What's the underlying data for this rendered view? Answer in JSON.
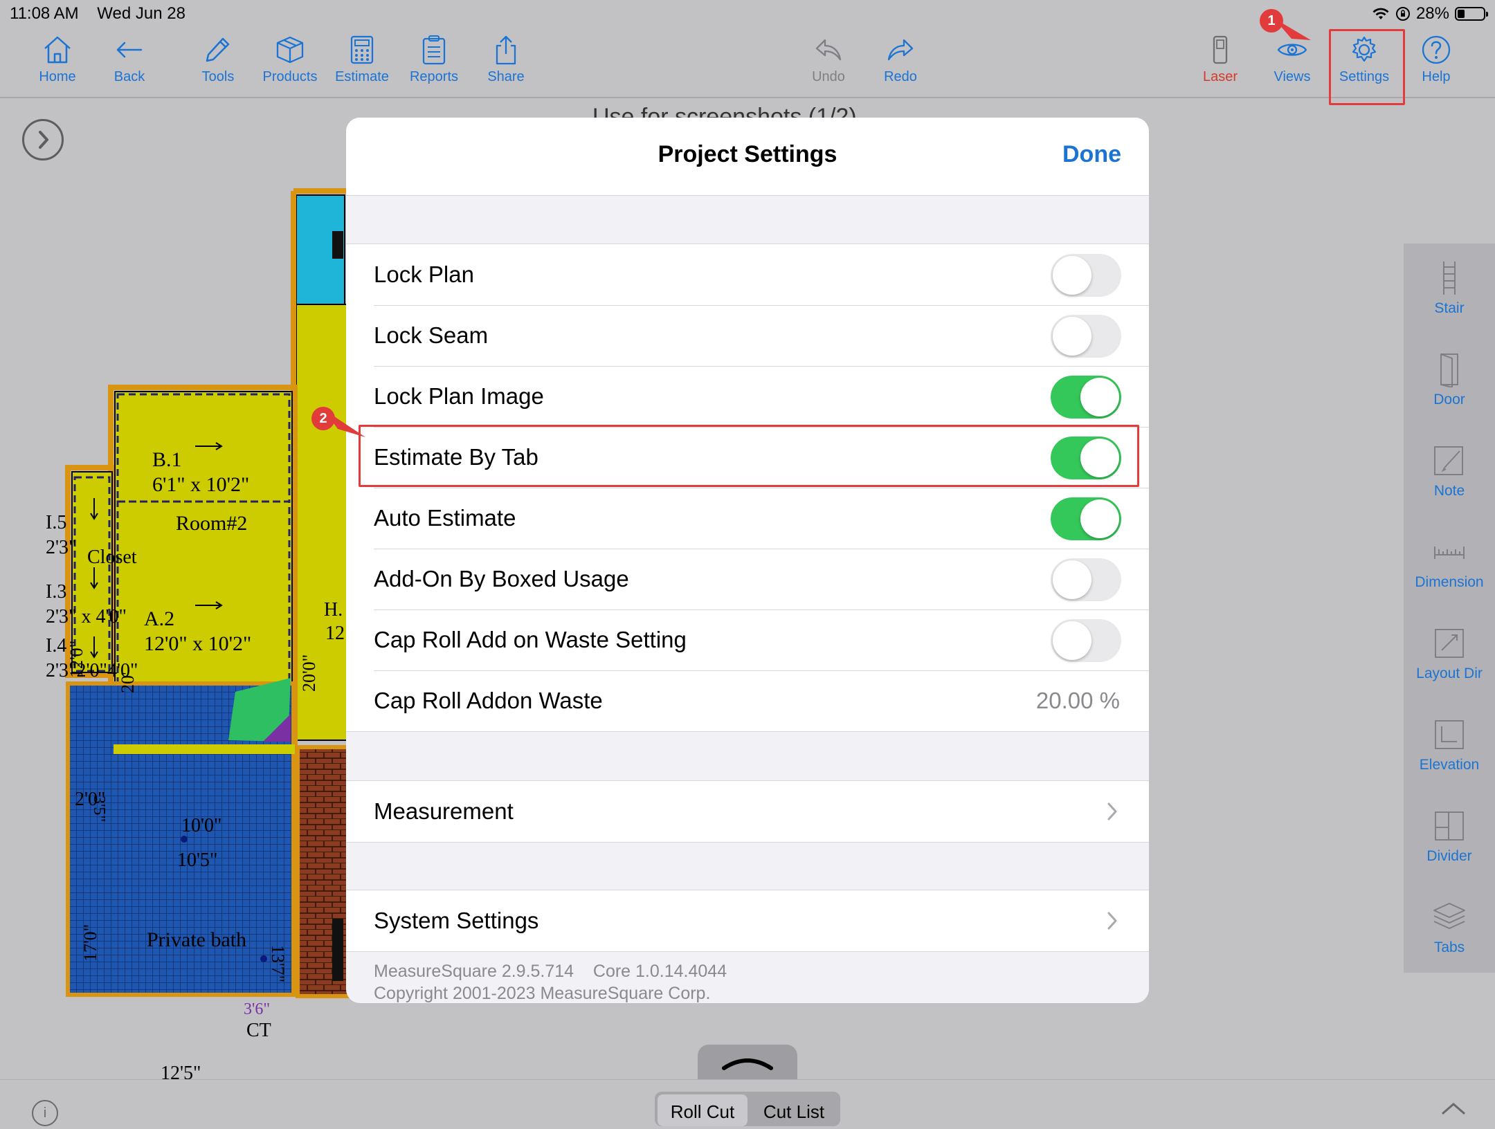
{
  "status_bar": {
    "time": "11:08 AM",
    "date": "Wed Jun 28",
    "battery": "28%",
    "battery_level": 0.28
  },
  "toolbar": {
    "left": [
      {
        "label": "Home",
        "icon": "home-icon"
      },
      {
        "label": "Back",
        "icon": "back-arrow-icon"
      },
      {
        "label": "Tools",
        "icon": "pencil-icon"
      },
      {
        "label": "Products",
        "icon": "box-icon"
      },
      {
        "label": "Estimate",
        "icon": "calculator-icon"
      },
      {
        "label": "Reports",
        "icon": "clipboard-icon"
      },
      {
        "label": "Share",
        "icon": "share-icon"
      }
    ],
    "center": [
      {
        "label": "Undo",
        "icon": "undo-icon",
        "enabled": false
      },
      {
        "label": "Redo",
        "icon": "redo-icon",
        "enabled": true
      }
    ],
    "right": [
      {
        "label": "Laser",
        "icon": "laser-device-icon"
      },
      {
        "label": "Views",
        "icon": "eye-icon"
      },
      {
        "label": "Settings",
        "icon": "gear-icon",
        "highlighted": true
      },
      {
        "label": "Help",
        "icon": "help-icon"
      }
    ]
  },
  "annotations": {
    "step1": "1",
    "step2": "2",
    "color": "#e23b3b"
  },
  "floor_plan": {
    "title_partial": "Use for screenshots (1/2)",
    "labels": {
      "b1": "B.1",
      "b1_size": "6'1\" x 10'2\"",
      "room2": "Room#2",
      "a2": "A.2",
      "a2_size": "12'0\" x 10'2\"",
      "closet": "Closet",
      "i5": "I.5",
      "i3": "I.3",
      "i4": "I.4",
      "d1": "2'3\"",
      "d2": "2'3\" x 4'0\"",
      "d3": "2'3\"2'0\"4'0\"",
      "dim_1": "12'0\"",
      "dim_2": "20'",
      "dim_3": "10'0\"",
      "dim_4": "10'5\"",
      "dim_5": "2'0\"",
      "dim_6": "3'5\"",
      "dim_7": "17'0\"",
      "dim_8": "13'7\"",
      "dim_9": "12'5\"",
      "dim_10": "20'0\"",
      "dim_11": "3'6\"",
      "private_bath": "Private bath",
      "ct": "CT",
      "h": "H.",
      "h_num": "12"
    }
  },
  "right_panel": [
    {
      "label": "Stair",
      "icon": "stair-icon"
    },
    {
      "label": "Door",
      "icon": "door-icon"
    },
    {
      "label": "Note",
      "icon": "note-icon"
    },
    {
      "label": "Dimension",
      "icon": "dimension-icon"
    },
    {
      "label": "Layout Dir",
      "icon": "layout-direction-icon"
    },
    {
      "label": "Elevation",
      "icon": "elevation-icon"
    },
    {
      "label": "Divider",
      "icon": "divider-icon"
    },
    {
      "label": "Tabs",
      "icon": "layers-icon"
    }
  ],
  "modal": {
    "title": "Project Settings",
    "done": "Done",
    "settings": [
      {
        "label": "Lock Plan",
        "on": false
      },
      {
        "label": "Lock Seam",
        "on": false
      },
      {
        "label": "Lock Plan Image",
        "on": true
      },
      {
        "label": "Estimate By Tab",
        "on": true,
        "highlighted": true
      },
      {
        "label": "Auto Estimate",
        "on": true
      },
      {
        "label": "Add-On By Boxed Usage",
        "on": false
      },
      {
        "label": "Cap Roll Add on Waste Setting",
        "on": false
      },
      {
        "label": "Cap Roll Addon Waste",
        "value": "20.00 %"
      }
    ],
    "measurement": "Measurement",
    "system_settings": "System Settings",
    "version": "MeasureSquare 2.9.5.714",
    "core": "Core 1.0.14.4044",
    "copyright": "Copyright 2001-2023 MeasureSquare Corp."
  },
  "bottom": {
    "roll_cut": "Roll Cut",
    "cut_list": "Cut List",
    "info": "i"
  },
  "colors": {
    "accent": "#1b73d3",
    "toggle_on": "#34c759",
    "laser": "#d43a2b"
  }
}
